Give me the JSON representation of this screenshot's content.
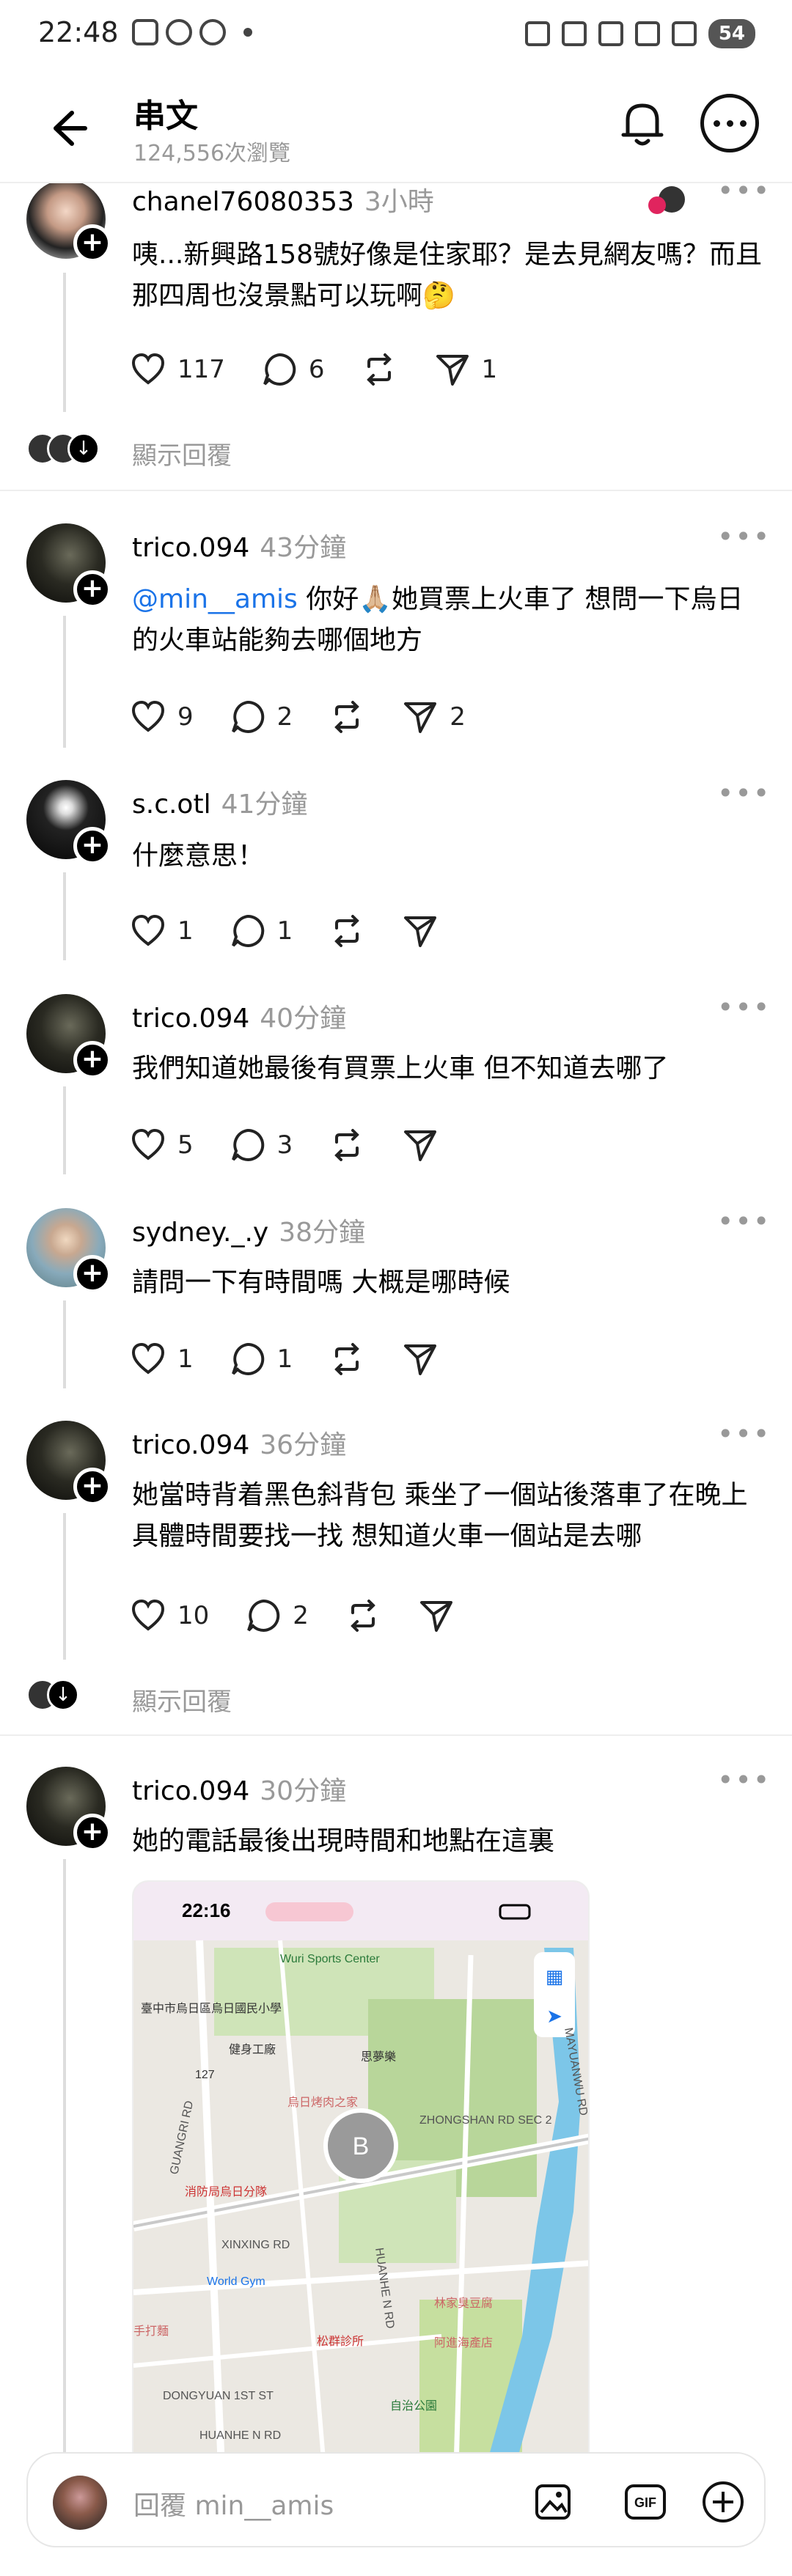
{
  "status_bar": {
    "time": "22:48",
    "battery": "54"
  },
  "header": {
    "title": "串文",
    "views": "124,556次瀏覽"
  },
  "posts": [
    {
      "user": "chanel76080353",
      "time": "3小時",
      "text": "咦...新興路158號好像是住家耶？是去見網友嗎？而且那四周也沒景點可以玩啊🤔",
      "likes": "117",
      "replies": "6",
      "reposts": "",
      "shares": "1",
      "show_replies": "顯示回覆"
    },
    {
      "user": "trico.094",
      "time": "43分鐘",
      "mention": "@min__amis",
      "text": " 你好🙏🏼她買票上火車了 想問一下烏日的火車站能夠去哪個地方",
      "likes": "9",
      "replies": "2",
      "reposts": "",
      "shares": "2"
    },
    {
      "user": "s.c.otl",
      "time": "41分鐘",
      "text": "什麼意思！",
      "likes": "1",
      "replies": "1",
      "reposts": "",
      "shares": ""
    },
    {
      "user": "trico.094",
      "time": "40分鐘",
      "text": "我們知道她最後有買票上火車￼ 但不知道去哪了",
      "likes": "5",
      "replies": "3",
      "reposts": "",
      "shares": ""
    },
    {
      "user": "sydney._.y",
      "time": "38分鐘",
      "text": "請問一下有時間嗎 大概是哪時候",
      "likes": "1",
      "replies": "1",
      "reposts": "",
      "shares": ""
    },
    {
      "user": "trico.094",
      "time": "36分鐘",
      "text": "她當時背着黑色斜背包 ￼乘坐了一個站後落車了在晚上 具體時間要找一找 想知道火車一個站是去哪",
      "likes": "10",
      "replies": "2",
      "reposts": "",
      "shares": "",
      "show_replies": "顯示回覆"
    },
    {
      "user": "trico.094",
      "time": "30分鐘",
      "text": "她的電話最後出現時間和地點在這裏"
    }
  ],
  "map": {
    "time": "22:16",
    "marker": "B",
    "labels": [
      "Wuri Sports Center",
      "臺中市烏日區烏日國民小學",
      "健身工廠",
      "思夢樂",
      "烏日烤肉之家",
      "ZHONGSHAN RD SEC 2",
      "GUANGRI RD",
      "消防局烏日分隊",
      "XINXING RD",
      "World Gym",
      "林家臭豆腐",
      "松群診所",
      "阿進海產店",
      "DONGYUAN 1ST ST",
      "自治公園",
      "手打麵",
      "MAYUANWU RD",
      "127",
      "HUANHE N RD",
      "HUANHE N RD"
    ]
  },
  "reply_bar": {
    "placeholder": "回覆 min__amis"
  }
}
